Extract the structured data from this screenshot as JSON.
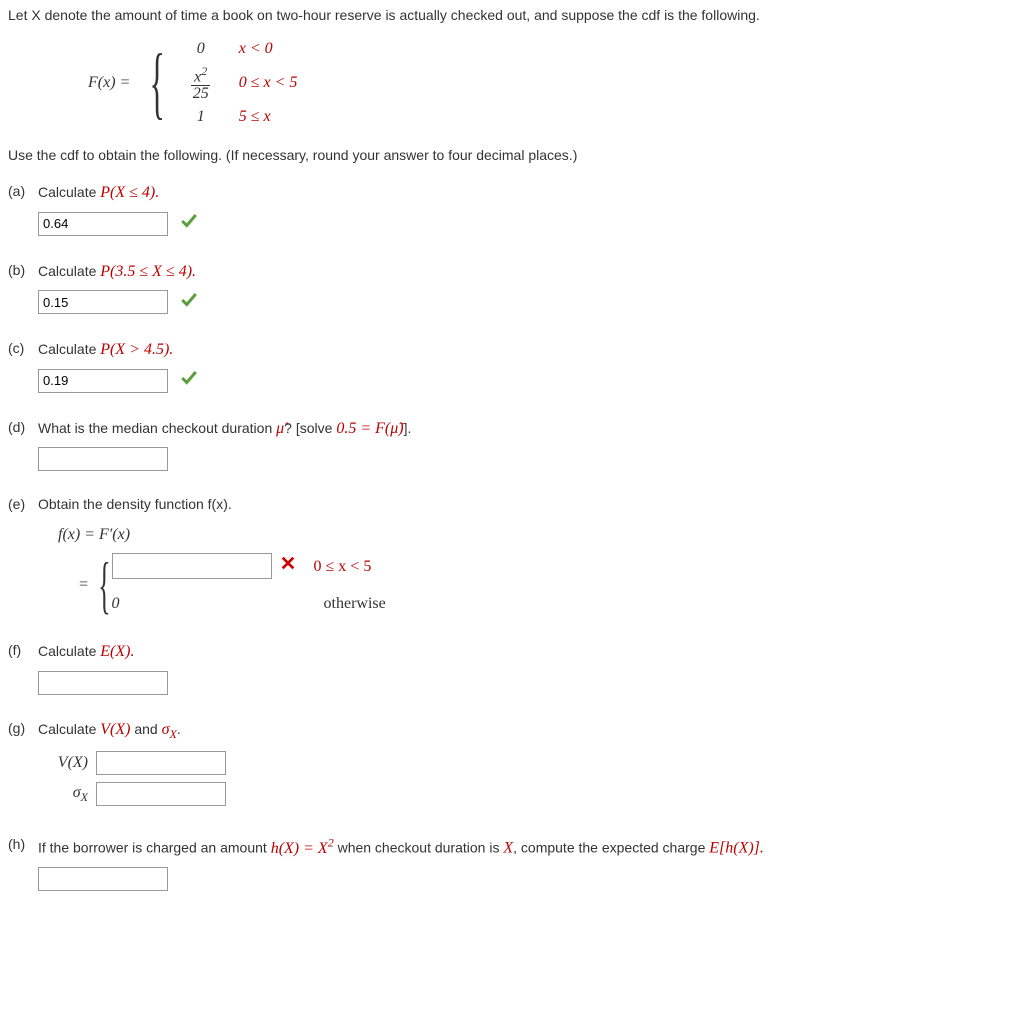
{
  "intro": "Let X denote the amount of time a book on two-hour reserve is actually checked out, and suppose the cdf is the following.",
  "cdf": {
    "lhs": "F(x) = ",
    "pieces": [
      {
        "val_top": "0",
        "val_bot": "",
        "cond": "x < 0"
      },
      {
        "val_top": "x",
        "val_sup": "2",
        "val_bot": "25",
        "cond": "0 ≤ x < 5"
      },
      {
        "val_top": "1",
        "val_bot": "",
        "cond": "5 ≤ x"
      }
    ]
  },
  "instr": "Use the cdf to obtain the following. (If necessary, round your answer to four decimal places.)",
  "parts": {
    "a": {
      "label": "(a)",
      "prompt_pre": "Calculate ",
      "prompt_math": "P(X ≤ 4).",
      "value": "0.64",
      "status": "correct"
    },
    "b": {
      "label": "(b)",
      "prompt_pre": "Calculate ",
      "prompt_math": "P(3.5 ≤ X ≤ 4).",
      "value": "0.15",
      "status": "correct"
    },
    "c": {
      "label": "(c)",
      "prompt_pre": "Calculate ",
      "prompt_math": "P(X > 4.5).",
      "value": "0.19",
      "status": "correct"
    },
    "d": {
      "label": "(d)",
      "prompt_pre": "What is the median checkout duration ",
      "mu": "μ̃",
      "prompt_post": "? [solve ",
      "eq": "0.5 = F(μ̃)",
      "prompt_end": "].",
      "value": ""
    },
    "e": {
      "label": "(e)",
      "prompt": "Obtain the density function f(x).",
      "line2_lhs": "f(x)  =  F′(x)",
      "eq": " = ",
      "case1_cond": "0 ≤ x < 5",
      "case2_val": "0",
      "case2_cond": "otherwise",
      "value": "",
      "status": "wrong"
    },
    "f": {
      "label": "(f)",
      "prompt_pre": "Calculate ",
      "prompt_math": "E(X).",
      "value": ""
    },
    "g": {
      "label": "(g)",
      "prompt_pre": "Calculate ",
      "vx": "V(X)",
      "and": " and ",
      "sigma": "σ",
      "sub": "X",
      "dot": ".",
      "row1_label": "V(X)",
      "row1_value": "",
      "row2_label": "σ",
      "row2_sub": "X",
      "row2_value": ""
    },
    "h": {
      "label": "(h)",
      "prompt_pre": "If the borrower is charged an amount ",
      "hx": "h(X) = X",
      "sup": "2",
      "prompt_mid": " when checkout duration is ",
      "X": "X",
      "prompt_post": ", compute the expected charge ",
      "ehx": "E[h(X)].",
      "value": ""
    }
  }
}
